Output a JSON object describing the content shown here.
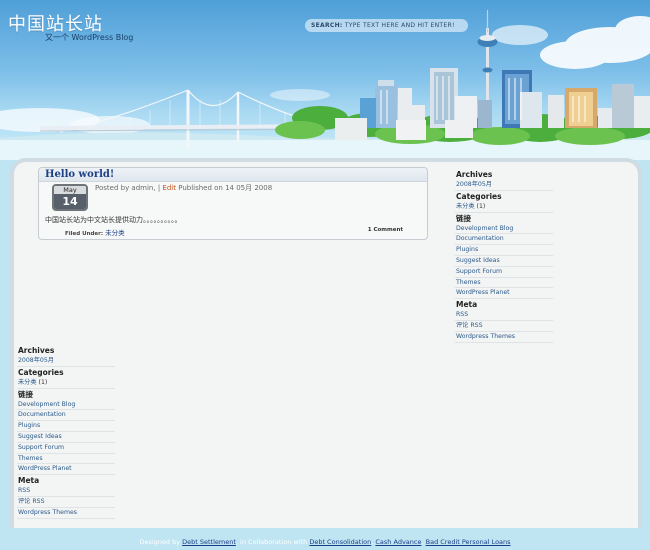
{
  "header": {
    "site_title": "中国站长站",
    "tagline": "又一个 WordPress Blog",
    "search_label": "Search:",
    "search_hint": "Type text here and hit enter!"
  },
  "post": {
    "title": "Hello world!",
    "date_month": "May",
    "date_day": "14",
    "meta_prefix": "Posted by admin, |",
    "meta_edit": "Edit",
    "meta_suffix": "Published on 14 05月 2008",
    "body": "中国站长站为中文站长提供动力。。。。。。。。。。",
    "filed_label": "Filed Under:",
    "category": "未分类",
    "comments": "1 Comment"
  },
  "sidebar": {
    "archives_title": "Archives",
    "archives": [
      "2008年05月"
    ],
    "categories_title": "Categories",
    "categories": [
      {
        "name": "未分类",
        "count": "(1)"
      }
    ],
    "links_title": "链接",
    "links": [
      "Development Blog",
      "Documentation",
      "Plugins",
      "Suggest Ideas",
      "Support Forum",
      "Themes",
      "WordPress Planet"
    ],
    "meta_title": "Meta",
    "meta": [
      "RSS",
      "评论 RSS",
      "Wordpress Themes"
    ]
  },
  "footer": {
    "designed_by": "Designed by",
    "link1": "Debt Settlement",
    "collab": ", in Collaboration with",
    "link2": "Debt Consolidation",
    "link3": "Cash Advance",
    "link4": "Bad Credit Personal Loans",
    "sep": ","
  },
  "colors": {
    "sky_top": "#4f9fd8",
    "link": "#2a5a8a",
    "title": "#1c3f86",
    "edit": "#c0541c"
  }
}
